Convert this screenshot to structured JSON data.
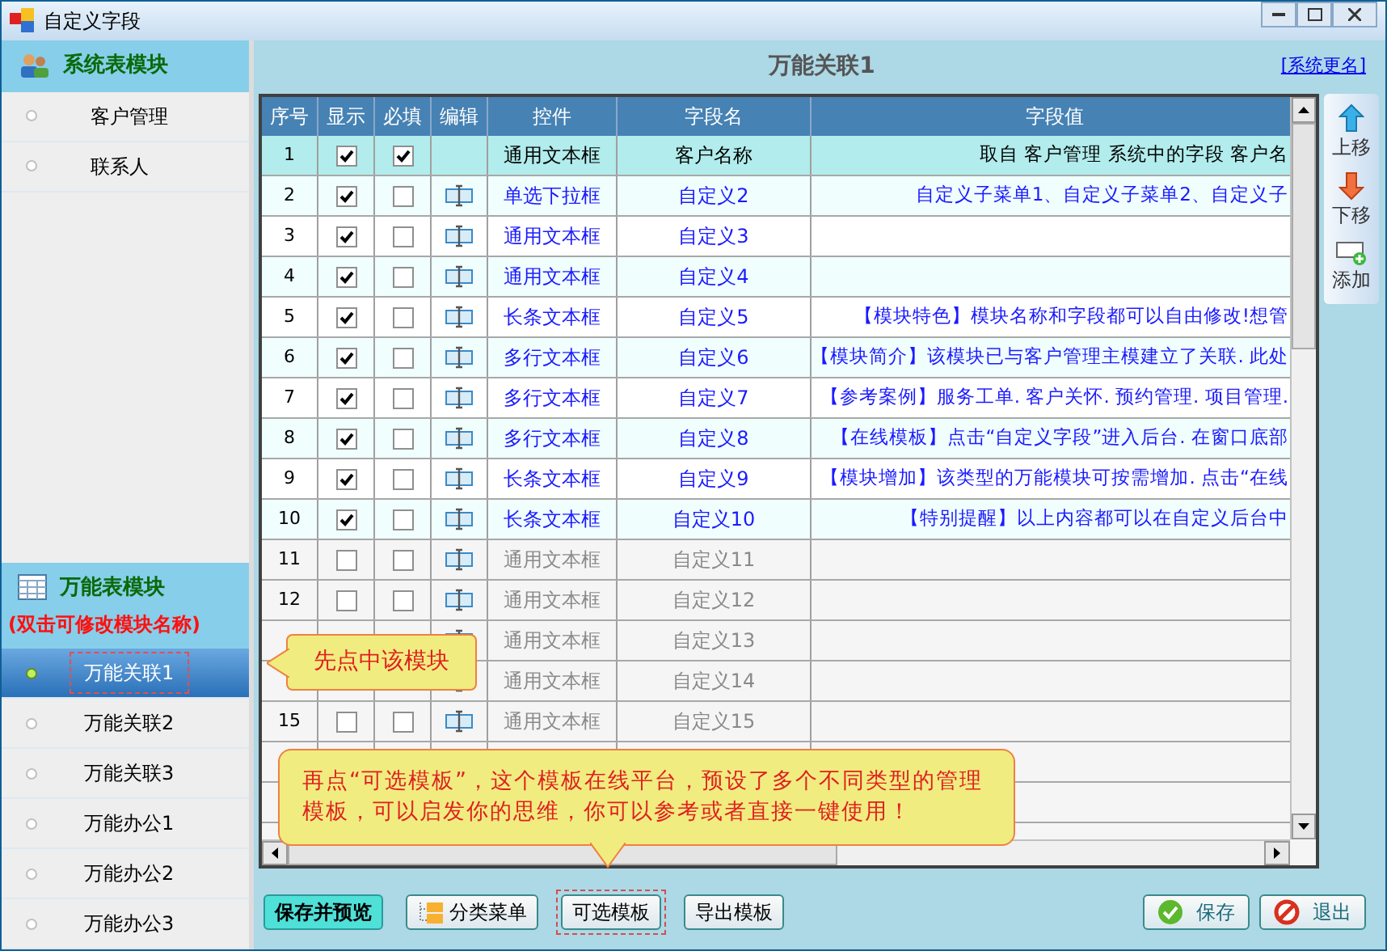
{
  "window": {
    "title": "自定义字段"
  },
  "sidebar": {
    "sections": [
      {
        "title": "系统表模块",
        "items": [
          {
            "label": "客户管理",
            "selected": false
          },
          {
            "label": "联系人",
            "selected": false
          }
        ]
      },
      {
        "title": "万能表模块",
        "note": "(双击可修改模块名称)",
        "items": [
          {
            "label": "万能关联1",
            "selected": true
          },
          {
            "label": "万能关联2",
            "selected": false
          },
          {
            "label": "万能关联3",
            "selected": false
          },
          {
            "label": "万能办公1",
            "selected": false
          },
          {
            "label": "万能办公2",
            "selected": false
          },
          {
            "label": "万能办公3",
            "selected": false
          }
        ]
      }
    ]
  },
  "module_title": "万能关联1",
  "rename_link": "[系统更名]",
  "table": {
    "columns": [
      "序号",
      "显示",
      "必填",
      "编辑",
      "控件",
      "字段名",
      "字段值"
    ],
    "rows": [
      {
        "kind": "system",
        "selected": true,
        "seq": "1",
        "show": true,
        "required": true,
        "control": "通用文本框",
        "field": "客户名称",
        "value": "取自 客户管理 系统中的字段 客户名"
      },
      {
        "kind": "custom",
        "selected": false,
        "seq": "2",
        "show": true,
        "required": false,
        "control": "单选下拉框",
        "field": "自定义2",
        "value": "自定义子菜单1、自定义子菜单2、自定义子"
      },
      {
        "kind": "custom",
        "selected": false,
        "seq": "3",
        "show": true,
        "required": false,
        "control": "通用文本框",
        "field": "自定义3"
      },
      {
        "kind": "custom",
        "selected": false,
        "seq": "4",
        "show": true,
        "required": false,
        "control": "通用文本框",
        "field": "自定义4"
      },
      {
        "kind": "custom",
        "selected": false,
        "seq": "5",
        "show": true,
        "required": false,
        "control": "长条文本框",
        "field": "自定义5",
        "value": "【模块特色】模块名称和字段都可以自由修改!想管"
      },
      {
        "kind": "custom",
        "selected": false,
        "seq": "6",
        "show": true,
        "required": false,
        "control": "多行文本框",
        "field": "自定义6",
        "value": "【模块简介】该模块已与客户管理主模建立了关联. 此处"
      },
      {
        "kind": "custom",
        "selected": false,
        "seq": "7",
        "show": true,
        "required": false,
        "control": "多行文本框",
        "field": "自定义7",
        "value": "【参考案例】服务工单. 客户关怀. 预约管理. 项目管理."
      },
      {
        "kind": "custom",
        "selected": false,
        "seq": "8",
        "show": true,
        "required": false,
        "control": "多行文本框",
        "field": "自定义8",
        "value": "【在线模板】点击“自定义字段”进入后台. 在窗口底部"
      },
      {
        "kind": "custom",
        "selected": false,
        "seq": "9",
        "show": true,
        "required": false,
        "control": "长条文本框",
        "field": "自定义9",
        "value": "【模块增加】该类型的万能模块可按需增加. 点击“在线"
      },
      {
        "kind": "custom",
        "selected": false,
        "seq": "10",
        "show": true,
        "required": false,
        "control": "长条文本框",
        "field": "自定义10",
        "value": "【特别提醒】以上内容都可以在自定义后台中"
      },
      {
        "kind": "unused",
        "selected": false,
        "seq": "11",
        "show": false,
        "required": false,
        "control": "通用文本框",
        "field": "自定义11"
      },
      {
        "kind": "unused",
        "selected": false,
        "seq": "12",
        "show": false,
        "required": false,
        "control": "通用文本框",
        "field": "自定义12"
      },
      {
        "kind": "unused",
        "selected": false,
        "control": "通用文本框",
        "field": "自定义13"
      },
      {
        "kind": "unused",
        "selected": false,
        "control": "通用文本框",
        "field": "自定义14"
      },
      {
        "kind": "unused",
        "selected": false,
        "seq": "15",
        "show": false,
        "required": false,
        "control": "通用文本框",
        "field": "自定义15"
      }
    ]
  },
  "side_tools": [
    "上移",
    "下移",
    "添加"
  ],
  "callouts": [
    "先点中该模块",
    "再点“可选模板”，这个模板在线平台，预设了多个不同类型的管理模板，可以启发你的思维，你可以参考或者直接一键使用！"
  ],
  "bottom_buttons": [
    {
      "label": "保存并预览",
      "kind": "primary"
    },
    {
      "label": "分类菜单",
      "kind": "menu"
    },
    {
      "label": "可选模板",
      "kind": "highlight"
    },
    {
      "label": "导出模板",
      "kind": "plain"
    }
  ],
  "action_buttons": [
    {
      "label": "保存",
      "kind": "ok"
    },
    {
      "label": "退出",
      "kind": "exit"
    }
  ]
}
